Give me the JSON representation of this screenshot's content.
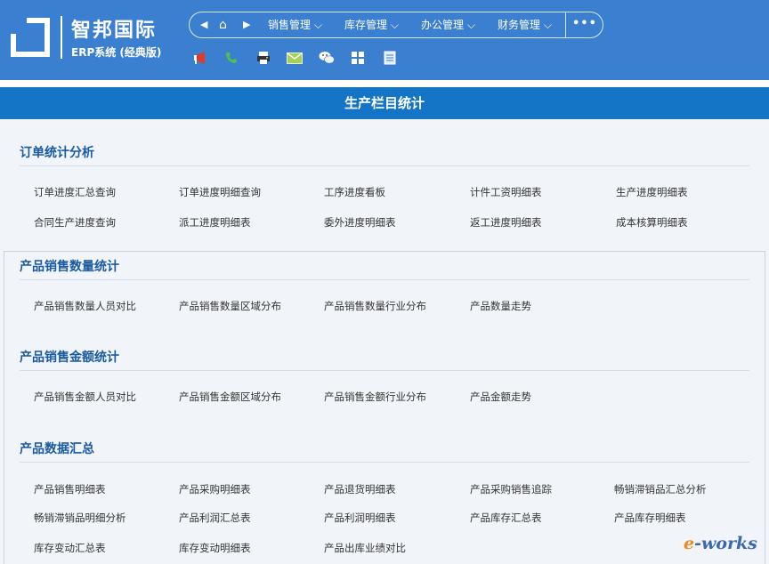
{
  "logo": {
    "title": "智邦国际",
    "subtitle": "ERP系统 (经典版)"
  },
  "nav": {
    "back_icon": "caret-left-icon",
    "home_icon": "home-icon",
    "forward_icon": "caret-right-icon",
    "menus": [
      {
        "label": "销售管理",
        "chevron": "chevron-down"
      },
      {
        "label": "库存管理",
        "chevron": "chevron-down"
      },
      {
        "label": "办公管理",
        "chevron": "chevron-down"
      },
      {
        "label": "财务管理",
        "chevron": "chevron-down"
      }
    ],
    "more_label": "•••"
  },
  "toolbar": {
    "icons": [
      "megaphone-icon",
      "phone-icon",
      "printer-icon",
      "mail-icon",
      "wechat-icon",
      "grid-icon",
      "notes-icon"
    ],
    "colors": {
      "megaphone": "#e03a2a",
      "phone": "#4cc24c",
      "mail": "#8bc34a",
      "grid": "#ffffff"
    }
  },
  "page_title": "生产栏目统计",
  "sections": [
    {
      "title": "订单统计分析",
      "links": [
        "订单进度汇总查询",
        "订单进度明细查询",
        "工序进度看板",
        "计件工资明细表",
        "生产进度明细表",
        "合同生产进度查询",
        "派工进度明细表",
        "委外进度明细表",
        "返工进度明细表",
        "成本核算明细表"
      ]
    },
    {
      "title": "产品销售数量统计",
      "links": [
        "产品销售数量人员对比",
        "产品销售数量区域分布",
        "产品销售数量行业分布",
        "产品数量走势"
      ]
    },
    {
      "title": "产品销售金额统计",
      "links": [
        "产品销售金额人员对比",
        "产品销售金额区域分布",
        "产品销售金额行业分布",
        "产品金额走势"
      ]
    },
    {
      "title": "产品数据汇总",
      "links": [
        "产品销售明细表",
        "产品采购明细表",
        "产品退货明细表",
        "产品采购销售追踪",
        "畅销滞销品汇总分析",
        "畅销滞销品明细分析",
        "产品利润汇总表",
        "产品利润明细表",
        "产品库存汇总表",
        "产品库存明细表",
        "库存变动汇总表",
        "库存变动明细表",
        "产品出库业绩对比"
      ]
    }
  ],
  "watermark": {
    "part1": "e",
    "part2": "-works"
  },
  "colors": {
    "header": "#3b7fd0",
    "title_bar": "#1474c6",
    "section_title": "#1a5aa0"
  }
}
